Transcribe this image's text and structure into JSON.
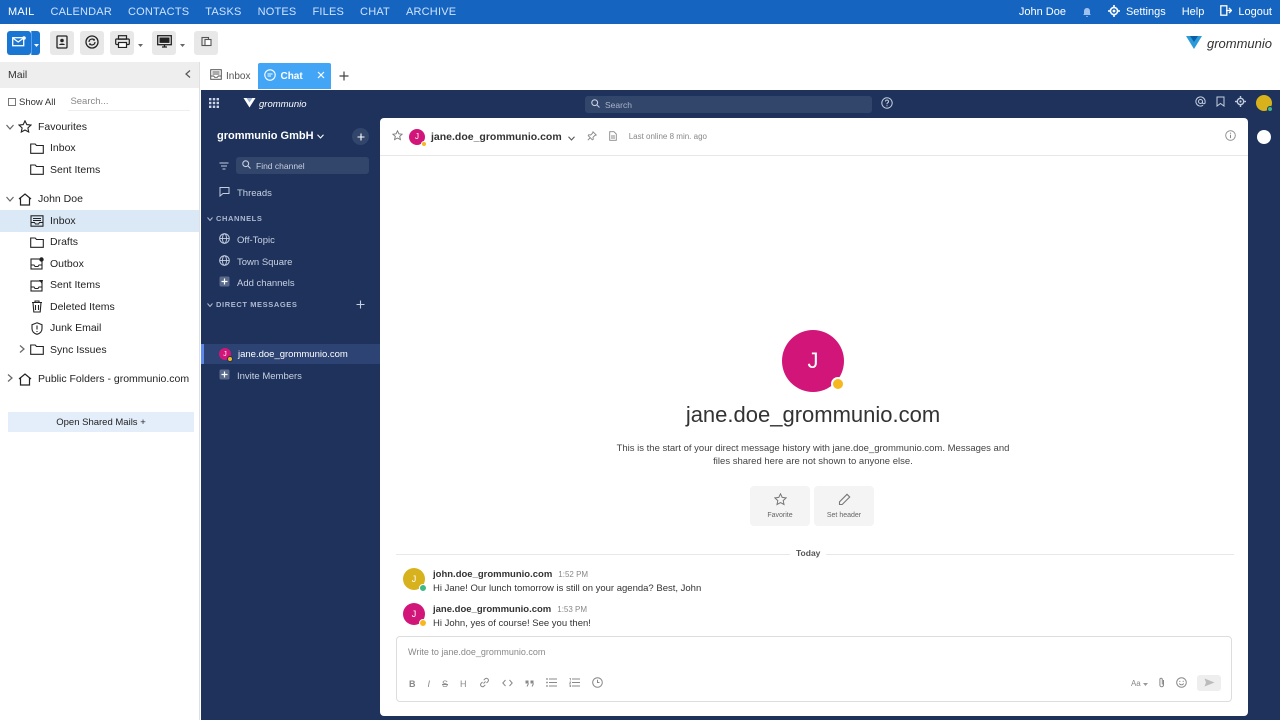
{
  "topnav": {
    "items": [
      "MAIL",
      "CALENDAR",
      "CONTACTS",
      "TASKS",
      "NOTES",
      "FILES",
      "CHAT",
      "ARCHIVE"
    ],
    "user": "John Doe",
    "settings": "Settings",
    "help": "Help",
    "logout": "Logout"
  },
  "toolbar": {
    "brand": "grommunio"
  },
  "sidebar": {
    "title": "Mail",
    "show_all": "Show All",
    "search_placeholder": "Search...",
    "favourites": "Favourites",
    "fav_items": [
      "Inbox",
      "Sent Items"
    ],
    "account": "John Doe",
    "folders": [
      "Inbox",
      "Drafts",
      "Outbox",
      "Sent Items",
      "Deleted Items",
      "Junk Email",
      "Sync Issues"
    ],
    "public_folders": "Public Folders - grommunio.com",
    "open_shared": "Open Shared Mails +"
  },
  "tabs": [
    {
      "label": "Inbox"
    },
    {
      "label": "Chat"
    }
  ],
  "chat": {
    "logo": "grommunio",
    "search_placeholder": "Search",
    "team": "grommunio GmbH",
    "find_placeholder": "Find channel",
    "threads": "Threads",
    "channels_label": "CHANNELS",
    "channels": [
      "Off-Topic",
      "Town Square",
      "Add channels"
    ],
    "dm_label": "DIRECT MESSAGES",
    "dm_user": "jane.doe_grommunio.com",
    "invite": "Invite Members",
    "header_name": "jane.doe_grommunio.com",
    "last_online": "Last online 8 min. ago",
    "big_initial": "J",
    "big_name": "jane.doe_grommunio.com",
    "intro": "This is the start of your direct message history with jane.doe_grommunio.com. Messages and files shared here are not shown to anyone else.",
    "favorite_label": "Favorite",
    "set_header_label": "Set header",
    "today": "Today",
    "messages": [
      {
        "user": "john.doe_grommunio.com",
        "time": "1:52 PM",
        "text": "Hi Jane! Our lunch tomorrow is still on your agenda? Best, John",
        "initial": "J",
        "color": "#d8b21c",
        "status": "#3db887"
      },
      {
        "user": "jane.doe_grommunio.com",
        "time": "1:53 PM",
        "text": "Hi John, yes of course! See you then!",
        "initial": "J",
        "color": "#d21579",
        "status": "#f5b91f"
      }
    ],
    "composer_placeholder": "Write to jane.doe_grommunio.com",
    "font_toggle": "Aa"
  }
}
